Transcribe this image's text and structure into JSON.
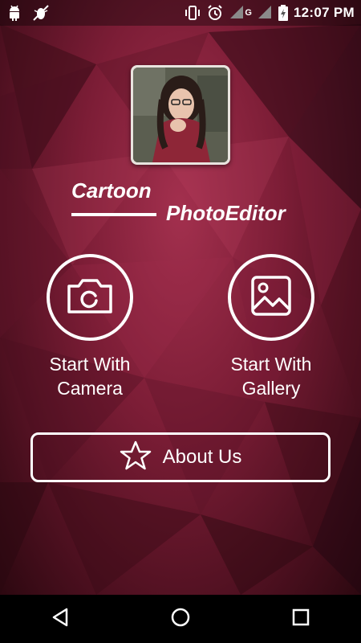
{
  "status_bar": {
    "time": "12:07 PM",
    "network_label": "G",
    "icons": [
      "android-icon",
      "bug-off-icon",
      "vibrate-icon",
      "alarm-icon",
      "signal-icon",
      "battery-charging-icon"
    ]
  },
  "header": {
    "title_word1": "Cartoon",
    "title_word2": "PhotoEditor"
  },
  "actions": {
    "camera": {
      "line1": "Start With",
      "line2": "Camera",
      "icon": "camera-icon"
    },
    "gallery": {
      "line1": "Start With",
      "line2": "Gallery",
      "icon": "image-icon"
    }
  },
  "about": {
    "label": "About Us",
    "icon": "star-icon"
  },
  "nav": {
    "icons": [
      "back-icon",
      "home-icon",
      "recents-icon"
    ]
  },
  "colors": {
    "accent": "#ffffff",
    "background": "#7c1d36",
    "navbar": "#000000"
  }
}
